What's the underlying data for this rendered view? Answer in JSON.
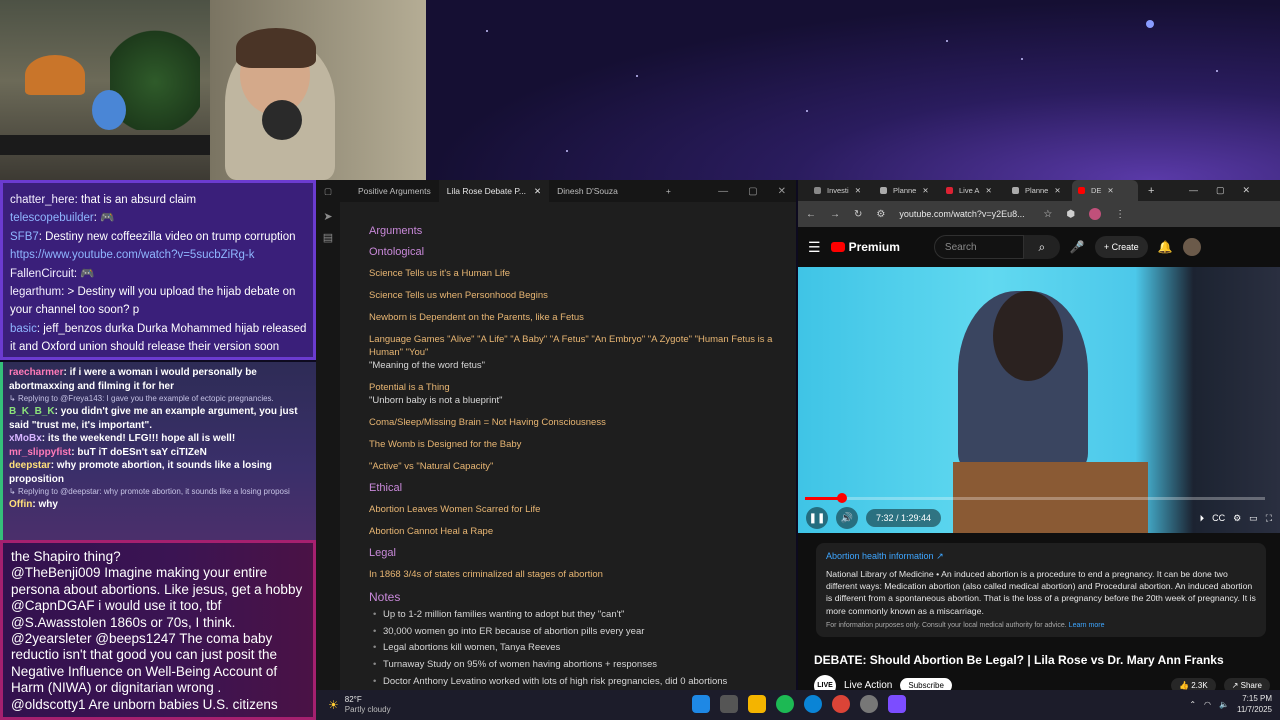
{
  "chat_top": [
    {
      "user": "chatter_here",
      "text": "that is an absurd claim"
    },
    {
      "user": "telescopebuilder",
      "text": ""
    },
    {
      "user": "SFB7",
      "text": "Destiny new coffeezilla video on trump corruption"
    },
    {
      "user": "",
      "text": "https://www.youtube.com/watch?v=5sucbZiRg-k"
    },
    {
      "user": "FallenCircuit",
      "text": ""
    },
    {
      "user": "legarthum",
      "text": "> Destiny will you upload the hijab debate on your channel too soon?"
    },
    {
      "user": "",
      "text": "p"
    },
    {
      "user": "basic",
      "text": "jeff_benzos durka Durka Mohammed hijab released it and Oxford union should release their version soon"
    }
  ],
  "chat_mid": [
    {
      "user": "raecharmer",
      "text": "if i were a woman i would personally be abortmaxxing and filming it for her"
    },
    {
      "reply": "Replying to @Freya143: I gave you the example of ectopic pregnancies."
    },
    {
      "user": "B_K_B_K",
      "text": "you didn't give me an example argument, you just said \"trust me, it's important\"."
    },
    {
      "user": "xMoBx",
      "text": "its the weekend! LFG!!! hope all is well!"
    },
    {
      "user": "mr_slippyfist",
      "text": "buT iT doESn't saY ciTIZeN"
    },
    {
      "user": "deepstar",
      "text": "why promote abortion, it sounds like a losing proposition"
    },
    {
      "reply": "Replying to @deepstar: why promote abortion, it sounds like a losing proposi"
    },
    {
      "user": "Offin",
      "text": "why"
    }
  ],
  "chat_bottom": [
    "the Shapiro thing?",
    "@TheBenji009 Imagine making your entire persona about abortions. Like jesus, get a hobby",
    "@CapnDGAF i would use it too, tbf",
    "@S.Awasstolen 1860s or 70s, I think.",
    "@2yearsleter @beeps1247 The coma baby reductio isn't that good you can just posit the Negative Influence on Well-Being Account of Harm (NIWA) or dignitarian wrong .",
    "@oldscotty1 Are unborn babies U.S. citizens"
  ],
  "obsidian": {
    "tabs": [
      "Positive Arguments",
      "Lila Rose Debate P...",
      "Dinesh D'Souza"
    ],
    "active_tab": 1,
    "heading_arguments": "Arguments",
    "heading_ontological": "Ontological",
    "ontological": [
      {
        "text": "Science Tells us it's a Human Life"
      },
      {
        "text": "Science Tells us when Personhood Begins"
      },
      {
        "text": "Newborn is Dependent on the Parents, like a Fetus"
      },
      {
        "text": "Language Games \"Alive\" \"A Life\" \"A Baby\" \"A Fetus\" \"An Embryo\" \"A Zygote\" \"Human Fetus is a Human\" \"You\"",
        "sub": "\"Meaning of the word fetus\""
      },
      {
        "text": "Potential is a Thing",
        "sub": "\"Unborn baby is not a blueprint\""
      },
      {
        "text": "Coma/Sleep/Missing Brain = Not Having Consciousness"
      },
      {
        "text": "The Womb is Designed for the Baby"
      },
      {
        "text": "\"Active\" vs \"Natural Capacity\""
      }
    ],
    "heading_ethical": "Ethical",
    "ethical": [
      "Abortion Leaves Women Scarred for Life",
      "Abortion Cannot Heal a Rape"
    ],
    "heading_legal": "Legal",
    "legal": [
      "In 1868 3/4s of states criminalized all stages of abortion"
    ],
    "heading_notes": "Notes",
    "notes": [
      "Up to 1-2 million families wanting to adopt but they \"can't\"",
      "30,000 women go into ER because of abortion pills every year",
      "Legal abortions kill women, Tanya Reeves",
      "Turnaway Study on 95% of women having abortions + responses",
      "Doctor Anthony Levatino worked with lots of high risk pregnancies, did 0 abortions"
    ]
  },
  "chrome": {
    "tabs": [
      "Investi",
      "Planne",
      "Live A",
      "Planne",
      "DE"
    ],
    "url": "youtube.com/watch?v=y2Eu8...",
    "yt_brand": "Premium",
    "search_placeholder": "Search",
    "create_label": "Create",
    "time": "7:32 / 1:29:44",
    "progress": 0.08,
    "info_heading": "Abortion health information",
    "info_body": "National Library of Medicine • An induced abortion is a procedure to end a pregnancy. It can be done two different ways: Medication abortion (also called medical abortion) and Procedural abortion. An induced abortion is different from a spontaneous abortion. That is the loss of a pregnancy before the 20th week of pregnancy. It is more commonly known as a miscarriage.",
    "info_footer": "For information purposes only. Consult your local medical authority for advice.",
    "info_learn": "Learn more",
    "video_title": "DEBATE: Should Abortion Be Legal? | Lila Rose vs Dr. Mary Ann Franks",
    "channel": "Live Action",
    "subscribe": "Subscribe",
    "likes": "2.3K",
    "share": "Share"
  },
  "taskbar": {
    "temp": "82°F",
    "weather": "Partly cloudy",
    "time": "7:15 PM",
    "date": "11/7/2025"
  }
}
